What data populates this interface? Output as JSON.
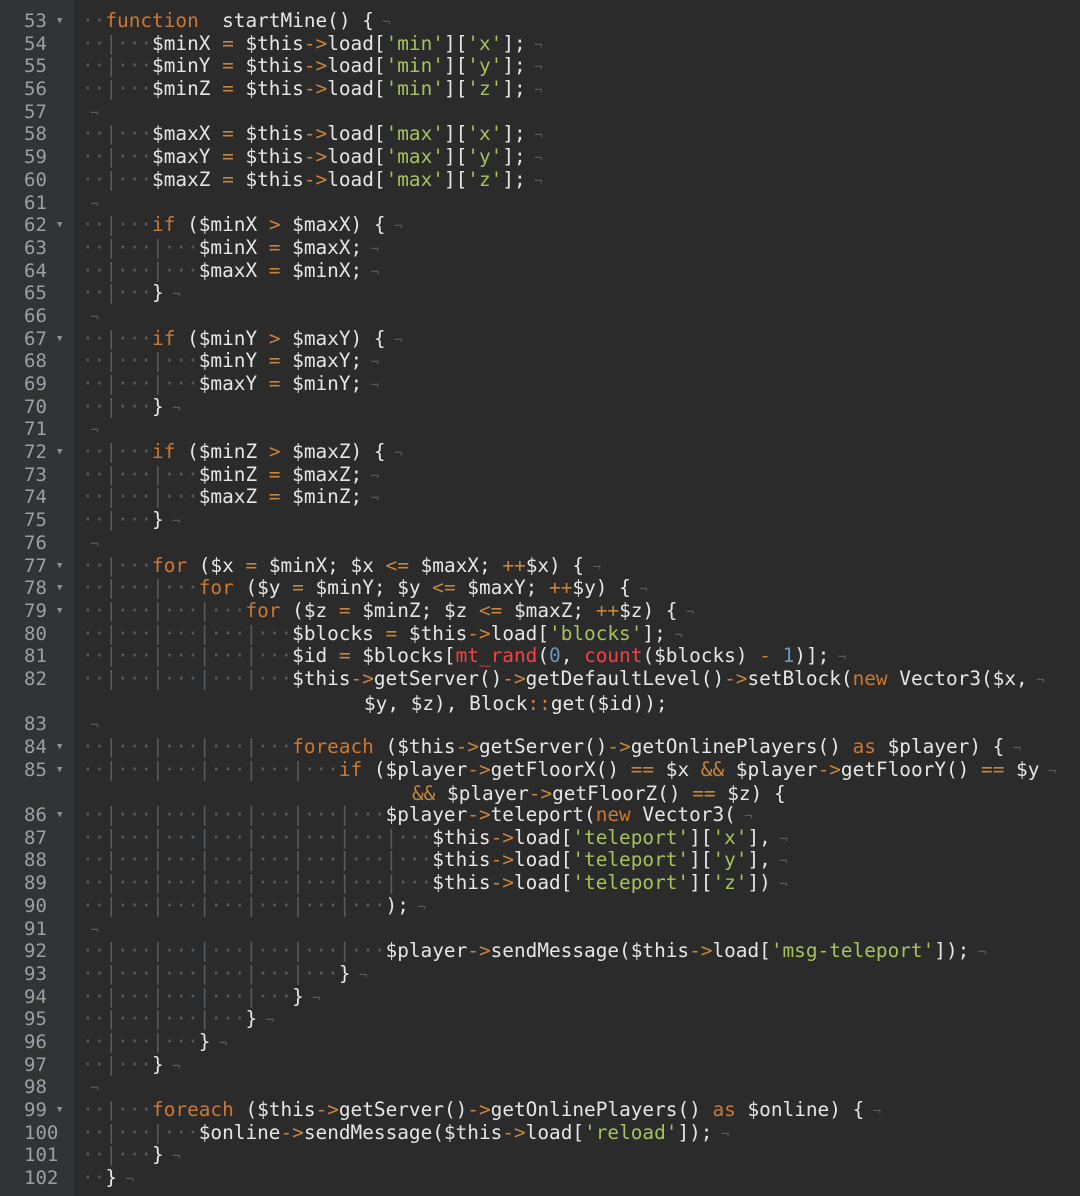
{
  "editor": {
    "lines": [
      {
        "n": "53",
        "fold": true,
        "ws": "··",
        "t": [
          [
            "kw",
            "function"
          ],
          [
            "",
            "  startMine() {"
          ]
        ]
      },
      {
        "n": "54",
        "ws": "··|···",
        "t": [
          [
            "",
            "$minX "
          ],
          [
            "op",
            "="
          ],
          [
            "",
            " $this"
          ],
          [
            "op",
            "->"
          ],
          [
            "",
            "load["
          ],
          [
            "st",
            "'min'"
          ],
          [
            "",
            "]["
          ],
          [
            "st",
            "'x'"
          ],
          [
            "",
            "];"
          ]
        ]
      },
      {
        "n": "55",
        "ws": "··|···",
        "t": [
          [
            "",
            "$minY "
          ],
          [
            "op",
            "="
          ],
          [
            "",
            " $this"
          ],
          [
            "op",
            "->"
          ],
          [
            "",
            "load["
          ],
          [
            "st",
            "'min'"
          ],
          [
            "",
            "]["
          ],
          [
            "st",
            "'y'"
          ],
          [
            "",
            "];"
          ]
        ]
      },
      {
        "n": "56",
        "ws": "··|···",
        "t": [
          [
            "",
            "$minZ "
          ],
          [
            "op",
            "="
          ],
          [
            "",
            " $this"
          ],
          [
            "op",
            "->"
          ],
          [
            "",
            "load["
          ],
          [
            "st",
            "'min'"
          ],
          [
            "",
            "]["
          ],
          [
            "st",
            "'z'"
          ],
          [
            "",
            "];"
          ]
        ]
      },
      {
        "n": "57",
        "ws": "",
        "t": []
      },
      {
        "n": "58",
        "ws": "··|···",
        "t": [
          [
            "",
            "$maxX "
          ],
          [
            "op",
            "="
          ],
          [
            "",
            " $this"
          ],
          [
            "op",
            "->"
          ],
          [
            "",
            "load["
          ],
          [
            "st",
            "'max'"
          ],
          [
            "",
            "]["
          ],
          [
            "st",
            "'x'"
          ],
          [
            "",
            "];"
          ]
        ]
      },
      {
        "n": "59",
        "ws": "··|···",
        "t": [
          [
            "",
            "$maxY "
          ],
          [
            "op",
            "="
          ],
          [
            "",
            " $this"
          ],
          [
            "op",
            "->"
          ],
          [
            "",
            "load["
          ],
          [
            "st",
            "'max'"
          ],
          [
            "",
            "]["
          ],
          [
            "st",
            "'y'"
          ],
          [
            "",
            "];"
          ]
        ]
      },
      {
        "n": "60",
        "ws": "··|···",
        "t": [
          [
            "",
            "$maxZ "
          ],
          [
            "op",
            "="
          ],
          [
            "",
            " $this"
          ],
          [
            "op",
            "->"
          ],
          [
            "",
            "load["
          ],
          [
            "st",
            "'max'"
          ],
          [
            "",
            "]["
          ],
          [
            "st",
            "'z'"
          ],
          [
            "",
            "];"
          ]
        ]
      },
      {
        "n": "61",
        "ws": "",
        "t": []
      },
      {
        "n": "62",
        "fold": true,
        "ws": "··|···",
        "t": [
          [
            "kw",
            "if"
          ],
          [
            "",
            " ($minX "
          ],
          [
            "op",
            ">"
          ],
          [
            "",
            " $maxX) {"
          ]
        ]
      },
      {
        "n": "63",
        "ws": "··|···|···",
        "t": [
          [
            "",
            "$minX "
          ],
          [
            "op",
            "="
          ],
          [
            "",
            " $maxX;"
          ]
        ]
      },
      {
        "n": "64",
        "ws": "··|···|···",
        "t": [
          [
            "",
            "$maxX "
          ],
          [
            "op",
            "="
          ],
          [
            "",
            " $minX;"
          ]
        ]
      },
      {
        "n": "65",
        "ws": "··|···",
        "t": [
          [
            "",
            "}"
          ]
        ]
      },
      {
        "n": "66",
        "ws": "",
        "t": []
      },
      {
        "n": "67",
        "fold": true,
        "ws": "··|···",
        "t": [
          [
            "kw",
            "if"
          ],
          [
            "",
            " ($minY "
          ],
          [
            "op",
            ">"
          ],
          [
            "",
            " $maxY) {"
          ]
        ]
      },
      {
        "n": "68",
        "ws": "··|···|···",
        "t": [
          [
            "",
            "$minY "
          ],
          [
            "op",
            "="
          ],
          [
            "",
            " $maxY;"
          ]
        ]
      },
      {
        "n": "69",
        "ws": "··|···|···",
        "t": [
          [
            "",
            "$maxY "
          ],
          [
            "op",
            "="
          ],
          [
            "",
            " $minY;"
          ]
        ]
      },
      {
        "n": "70",
        "ws": "··|···",
        "t": [
          [
            "",
            "}"
          ]
        ]
      },
      {
        "n": "71",
        "ws": "",
        "t": []
      },
      {
        "n": "72",
        "fold": true,
        "ws": "··|···",
        "t": [
          [
            "kw",
            "if"
          ],
          [
            "",
            " ($minZ "
          ],
          [
            "op",
            ">"
          ],
          [
            "",
            " $maxZ) {"
          ]
        ]
      },
      {
        "n": "73",
        "ws": "··|···|···",
        "t": [
          [
            "",
            "$minZ "
          ],
          [
            "op",
            "="
          ],
          [
            "",
            " $maxZ;"
          ]
        ]
      },
      {
        "n": "74",
        "ws": "··|···|···",
        "t": [
          [
            "",
            "$maxZ "
          ],
          [
            "op",
            "="
          ],
          [
            "",
            " $minZ;"
          ]
        ]
      },
      {
        "n": "75",
        "ws": "··|···",
        "t": [
          [
            "",
            "}"
          ]
        ]
      },
      {
        "n": "76",
        "ws": "",
        "t": []
      },
      {
        "n": "77",
        "fold": true,
        "ws": "··|···",
        "t": [
          [
            "kw",
            "for"
          ],
          [
            "",
            " ($x "
          ],
          [
            "op",
            "="
          ],
          [
            "",
            " $minX; $x "
          ],
          [
            "op",
            "<="
          ],
          [
            "",
            " $maxX; "
          ],
          [
            "op",
            "++"
          ],
          [
            "",
            "$x) {"
          ]
        ]
      },
      {
        "n": "78",
        "fold": true,
        "ws": "··|···|···",
        "t": [
          [
            "kw",
            "for"
          ],
          [
            "",
            " ($y "
          ],
          [
            "op",
            "="
          ],
          [
            "",
            " $minY; $y "
          ],
          [
            "op",
            "<="
          ],
          [
            "",
            " $maxY; "
          ],
          [
            "op",
            "++"
          ],
          [
            "",
            "$y) {"
          ]
        ]
      },
      {
        "n": "79",
        "fold": true,
        "ws": "··|···|···|···",
        "t": [
          [
            "kw",
            "for"
          ],
          [
            "",
            " ($z "
          ],
          [
            "op",
            "="
          ],
          [
            "",
            " $minZ; $z "
          ],
          [
            "op",
            "<="
          ],
          [
            "",
            " $maxZ; "
          ],
          [
            "op",
            "++"
          ],
          [
            "",
            "$z) {"
          ]
        ]
      },
      {
        "n": "80",
        "ws": "··|···|···|···|···",
        "t": [
          [
            "",
            "$blocks "
          ],
          [
            "op",
            "="
          ],
          [
            "",
            " $this"
          ],
          [
            "op",
            "->"
          ],
          [
            "",
            "load["
          ],
          [
            "st",
            "'blocks'"
          ],
          [
            "",
            "];"
          ]
        ]
      },
      {
        "n": "81",
        "ws": "··|···|···|···|···",
        "t": [
          [
            "",
            "$id "
          ],
          [
            "op",
            "="
          ],
          [
            "",
            " $blocks["
          ],
          [
            "fn",
            "mt_rand"
          ],
          [
            "",
            "("
          ],
          [
            "nm",
            "0"
          ],
          [
            "",
            ", "
          ],
          [
            "fn",
            "count"
          ],
          [
            "",
            "($blocks) "
          ],
          [
            "op",
            "-"
          ],
          [
            "",
            " "
          ],
          [
            "nm",
            "1"
          ],
          [
            "",
            ")];"
          ]
        ]
      },
      {
        "n": "82",
        "tall": true,
        "ws": "··|···|···|···|···",
        "t": [
          [
            "",
            "$this"
          ],
          [
            "op",
            "->"
          ],
          [
            "",
            "getServer()"
          ],
          [
            "op",
            "->"
          ],
          [
            "",
            "getDefaultLevel()"
          ],
          [
            "op",
            "->"
          ],
          [
            "",
            "setBlock("
          ],
          [
            "kw",
            "new"
          ],
          [
            "",
            " Vector3($x,"
          ]
        ],
        "wrap": [
          [
            "",
            "$y, $z), Block"
          ],
          [
            "op",
            "::"
          ],
          [
            "",
            "get($id));"
          ]
        ]
      },
      {
        "n": "83",
        "ws": "",
        "t": []
      },
      {
        "n": "84",
        "fold": true,
        "ws": "··|···|···|···|···",
        "t": [
          [
            "kw",
            "foreach"
          ],
          [
            "",
            " ($this"
          ],
          [
            "op",
            "->"
          ],
          [
            "",
            "getServer()"
          ],
          [
            "op",
            "->"
          ],
          [
            "",
            "getOnlinePlayers() "
          ],
          [
            "kw",
            "as"
          ],
          [
            "",
            " $player) {"
          ]
        ]
      },
      {
        "n": "85",
        "tall": true,
        "fold": true,
        "ws": "··|···|···|···|···|···",
        "t": [
          [
            "kw",
            "if"
          ],
          [
            "",
            " ($player"
          ],
          [
            "op",
            "->"
          ],
          [
            "",
            "getFloorX() "
          ],
          [
            "op",
            "=="
          ],
          [
            "",
            " $x "
          ],
          [
            "op",
            "&&"
          ],
          [
            "",
            " $player"
          ],
          [
            "op",
            "->"
          ],
          [
            "",
            "getFloorY() "
          ],
          [
            "op",
            "=="
          ],
          [
            "",
            " $y"
          ]
        ],
        "wrap2": [
          [
            "op",
            "&&"
          ],
          [
            "",
            " $player"
          ],
          [
            "op",
            "->"
          ],
          [
            "",
            "getFloorZ() "
          ],
          [
            "op",
            "=="
          ],
          [
            "",
            " $z) {"
          ]
        ]
      },
      {
        "n": "86",
        "fold": true,
        "ws": "··|···|···|···|···|···|···",
        "t": [
          [
            "",
            "$player"
          ],
          [
            "op",
            "->"
          ],
          [
            "",
            "teleport("
          ],
          [
            "kw",
            "new"
          ],
          [
            "",
            " Vector3("
          ]
        ]
      },
      {
        "n": "87",
        "ws": "··|···|···|···|···|···|···|···",
        "t": [
          [
            "",
            "$this"
          ],
          [
            "op",
            "->"
          ],
          [
            "",
            "load["
          ],
          [
            "st",
            "'teleport'"
          ],
          [
            "",
            "]["
          ],
          [
            "st",
            "'x'"
          ],
          [
            "",
            "],"
          ]
        ]
      },
      {
        "n": "88",
        "ws": "··|···|···|···|···|···|···|···",
        "t": [
          [
            "",
            "$this"
          ],
          [
            "op",
            "->"
          ],
          [
            "",
            "load["
          ],
          [
            "st",
            "'teleport'"
          ],
          [
            "",
            "]["
          ],
          [
            "st",
            "'y'"
          ],
          [
            "",
            "],"
          ]
        ]
      },
      {
        "n": "89",
        "ws": "··|···|···|···|···|···|···|···",
        "t": [
          [
            "",
            "$this"
          ],
          [
            "op",
            "->"
          ],
          [
            "",
            "load["
          ],
          [
            "st",
            "'teleport'"
          ],
          [
            "",
            "]["
          ],
          [
            "st",
            "'z'"
          ],
          [
            "",
            "])"
          ]
        ]
      },
      {
        "n": "90",
        "ws": "··|···|···|···|···|···|···",
        "t": [
          [
            "",
            ");"
          ]
        ]
      },
      {
        "n": "91",
        "ws": "",
        "t": []
      },
      {
        "n": "92",
        "ws": "··|···|···|···|···|···|···",
        "t": [
          [
            "",
            "$player"
          ],
          [
            "op",
            "->"
          ],
          [
            "",
            "sendMessage($this"
          ],
          [
            "op",
            "->"
          ],
          [
            "",
            "load["
          ],
          [
            "st",
            "'msg-teleport'"
          ],
          [
            "",
            "]);"
          ]
        ]
      },
      {
        "n": "93",
        "ws": "··|···|···|···|···|···",
        "t": [
          [
            "",
            "}"
          ]
        ]
      },
      {
        "n": "94",
        "ws": "··|···|···|···|···",
        "t": [
          [
            "",
            "}"
          ]
        ]
      },
      {
        "n": "95",
        "ws": "··|···|···|···",
        "t": [
          [
            "",
            "}"
          ]
        ]
      },
      {
        "n": "96",
        "ws": "··|···|···",
        "t": [
          [
            "",
            "}"
          ]
        ]
      },
      {
        "n": "97",
        "ws": "··|···",
        "t": [
          [
            "",
            "}"
          ]
        ]
      },
      {
        "n": "98",
        "ws": "",
        "t": []
      },
      {
        "n": "99",
        "fold": true,
        "ws": "··|···",
        "t": [
          [
            "kw",
            "foreach"
          ],
          [
            "",
            " ($this"
          ],
          [
            "op",
            "->"
          ],
          [
            "",
            "getServer()"
          ],
          [
            "op",
            "->"
          ],
          [
            "",
            "getOnlinePlayers() "
          ],
          [
            "kw",
            "as"
          ],
          [
            "",
            " $online) {"
          ]
        ]
      },
      {
        "n": "100",
        "ws": "··|···|···",
        "t": [
          [
            "",
            "$online"
          ],
          [
            "op",
            "->"
          ],
          [
            "",
            "sendMessage($this"
          ],
          [
            "op",
            "->"
          ],
          [
            "",
            "load["
          ],
          [
            "st",
            "'reload'"
          ],
          [
            "",
            "]);"
          ]
        ]
      },
      {
        "n": "101",
        "ws": "··|···",
        "t": [
          [
            "",
            "}"
          ]
        ]
      },
      {
        "n": "102",
        "ws": "··",
        "t": [
          [
            "",
            "}"
          ]
        ]
      }
    ]
  }
}
